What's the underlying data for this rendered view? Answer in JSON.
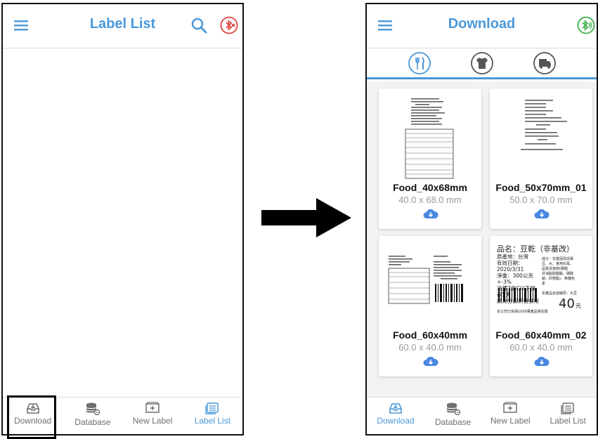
{
  "left_screen": {
    "header": {
      "title": "Label List",
      "menu_icon": "menu-icon",
      "search_icon": "search-icon",
      "bt_icon": "bluetooth-off-icon"
    },
    "bottom_nav": [
      {
        "label": "Download",
        "icon": "download-tray-icon"
      },
      {
        "label": "Database",
        "icon": "database-icon"
      },
      {
        "label": "New Label",
        "icon": "new-label-icon"
      },
      {
        "label": "Label List",
        "icon": "label-list-icon"
      }
    ]
  },
  "right_screen": {
    "header": {
      "title": "Download",
      "menu_icon": "menu-icon",
      "bt_icon": "bluetooth-connected-icon"
    },
    "categories": [
      {
        "icon": "utensils-icon"
      },
      {
        "icon": "tshirt-icon"
      },
      {
        "icon": "truck-package-icon"
      }
    ],
    "cards": [
      {
        "name": "Food_40x68mm",
        "size": "40.0 x 68.0 mm"
      },
      {
        "name": "Food_50x70mm_01",
        "size": "50.0 x 70.0 mm"
      },
      {
        "name": "Food_60x40mm",
        "size": "60.0 x 40.0 mm"
      },
      {
        "name": "Food_60x40mm_02",
        "size": "60.0 x 40.0 mm"
      }
    ],
    "card4_preview": {
      "line1": "品名：豆乾（非基改）",
      "line2": "原產地：台灣",
      "line3": "有效日期：2020/3/31",
      "line4": "淨重：300公克+-3%",
      "line5": "冷藏7度C以下保存5天",
      "line6": "請充分加熱後食用",
      "side1": "成分：非基因改造黃",
      "side2": "豆、水、食用石膏、",
      "side3": "品質改良劑(碳酸",
      "side4": "甘油脂肪酸酯、碳酸",
      "side5": "鈉、矽樹脂)、焦糖色",
      "side6": "素",
      "price_label": "本產品含過敏原：大豆",
      "price": "40",
      "price_unit": "元",
      "footer": "本公司已投保1000萬產品責任險"
    },
    "bottom_nav": [
      {
        "label": "Download",
        "icon": "download-tray-icon"
      },
      {
        "label": "Database",
        "icon": "database-icon"
      },
      {
        "label": "New Label",
        "icon": "new-label-icon"
      },
      {
        "label": "Label List",
        "icon": "label-list-icon"
      }
    ]
  },
  "colors": {
    "accent": "#4a98d9",
    "bt_off": "#e0403c",
    "bt_on": "#3fb04a",
    "nav_grey": "#6f6f6f"
  }
}
